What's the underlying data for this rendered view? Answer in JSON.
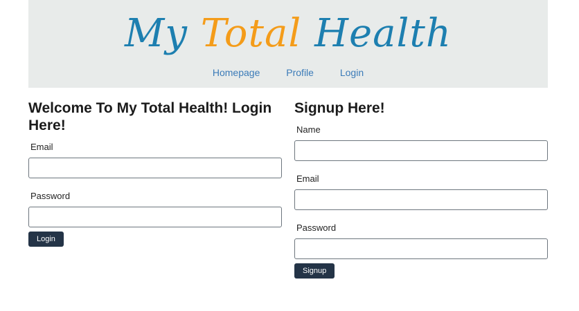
{
  "brand": {
    "word1": "My",
    "word2": "Total",
    "word3": "Health",
    "colors": {
      "primary": "#1d7fb0",
      "accent": "#f49c1a"
    }
  },
  "nav": {
    "items": [
      {
        "label": "Homepage"
      },
      {
        "label": "Profile"
      },
      {
        "label": "Login"
      }
    ]
  },
  "login": {
    "heading": "Welcome To My Total Health! Login Here!",
    "email_label": "Email",
    "email_value": "",
    "password_label": "Password",
    "password_value": "",
    "button": "Login"
  },
  "signup": {
    "heading": "Signup Here!",
    "name_label": "Name",
    "name_value": "",
    "email_label": "Email",
    "email_value": "",
    "password_label": "Password",
    "password_value": "",
    "button": "Signup"
  }
}
